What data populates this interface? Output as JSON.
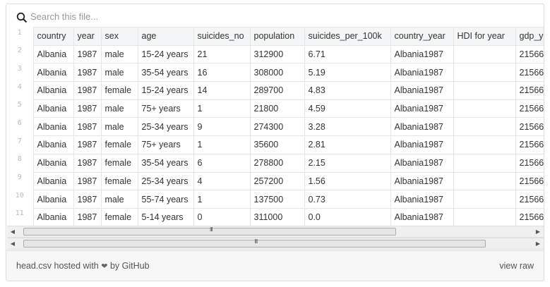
{
  "search": {
    "placeholder": "Search this file..."
  },
  "table": {
    "line_numbers": [
      "1",
      "2",
      "3",
      "4",
      "5",
      "6",
      "7",
      "8",
      "9",
      "10",
      "11"
    ],
    "headers": [
      "country",
      "year",
      "sex",
      "age",
      "suicides_no",
      "population",
      "suicides_per_100k",
      "country_year",
      "HDI for year",
      "gdp_y"
    ],
    "rows": [
      [
        "Albania",
        "1987",
        "male",
        "15-24 years",
        "21",
        "312900",
        "6.71",
        "Albania1987",
        "",
        "21566"
      ],
      [
        "Albania",
        "1987",
        "male",
        "35-54 years",
        "16",
        "308000",
        "5.19",
        "Albania1987",
        "",
        "21566"
      ],
      [
        "Albania",
        "1987",
        "female",
        "15-24 years",
        "14",
        "289700",
        "4.83",
        "Albania1987",
        "",
        "21566"
      ],
      [
        "Albania",
        "1987",
        "male",
        "75+ years",
        "1",
        "21800",
        "4.59",
        "Albania1987",
        "",
        "21566"
      ],
      [
        "Albania",
        "1987",
        "male",
        "25-34 years",
        "9",
        "274300",
        "3.28",
        "Albania1987",
        "",
        "21566"
      ],
      [
        "Albania",
        "1987",
        "female",
        "75+ years",
        "1",
        "35600",
        "2.81",
        "Albania1987",
        "",
        "21566"
      ],
      [
        "Albania",
        "1987",
        "female",
        "35-54 years",
        "6",
        "278800",
        "2.15",
        "Albania1987",
        "",
        "21566"
      ],
      [
        "Albania",
        "1987",
        "female",
        "25-34 years",
        "4",
        "257200",
        "1.56",
        "Albania1987",
        "",
        "21566"
      ],
      [
        "Albania",
        "1987",
        "male",
        "55-74 years",
        "1",
        "137500",
        "0.73",
        "Albania1987",
        "",
        "21566"
      ],
      [
        "Albania",
        "1987",
        "female",
        "5-14 years",
        "0",
        "311000",
        "0.0",
        "Albania1987",
        "",
        "21566"
      ]
    ]
  },
  "scrollbars": {
    "left_arrow": "◀",
    "right_arrow": "▶",
    "grip": "III"
  },
  "footer": {
    "file_name": "head.csv",
    "hosted_with": "hosted with",
    "heart": "❤",
    "by": "by",
    "host": "GitHub",
    "view_raw": "view raw"
  },
  "colors": {
    "header_bg": "#f4f5f6",
    "footer_bg": "#f7f7f7",
    "border": "#dddddd"
  }
}
